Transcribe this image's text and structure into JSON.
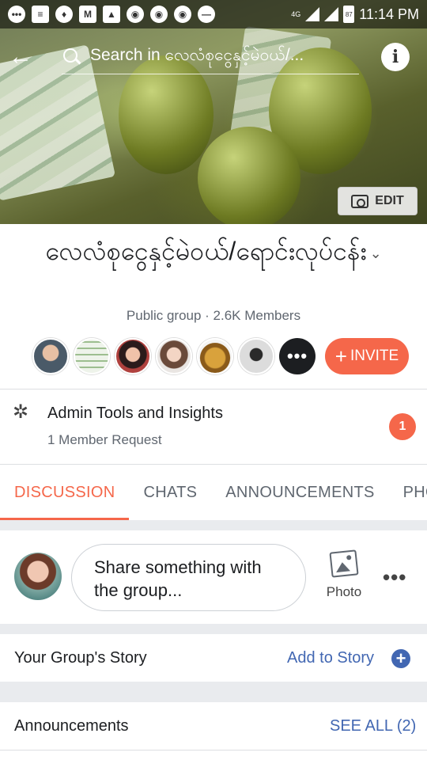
{
  "status_bar": {
    "network": "4G",
    "battery": "87",
    "time": "11:14 PM"
  },
  "search": {
    "placeholder": "Search in လေလံစုငွေနှင့်မဲဝယ်/..."
  },
  "cover": {
    "edit_label": "EDIT"
  },
  "group": {
    "name": "လေလံစုငွေနှင့်မဲဝယ်/ရောင်းလုပ်ငန်း",
    "meta": "Public group · 2.6K Members",
    "invite_label": "INVITE"
  },
  "admin": {
    "title": "Admin Tools and Insights",
    "subtitle": "1 Member Request",
    "badge_count": "1"
  },
  "tabs": [
    "DISCUSSION",
    "CHATS",
    "ANNOUNCEMENTS",
    "PHOTOS"
  ],
  "composer": {
    "prompt": "Share something with the group...",
    "photo_label": "Photo"
  },
  "story": {
    "title": "Your Group's Story",
    "link": "Add to Story"
  },
  "announcements": {
    "title": "Announcements",
    "link": "SEE ALL (2)"
  },
  "colors": {
    "accent": "#f5674a",
    "link": "#4267b2",
    "divider": "#dddfe2"
  }
}
